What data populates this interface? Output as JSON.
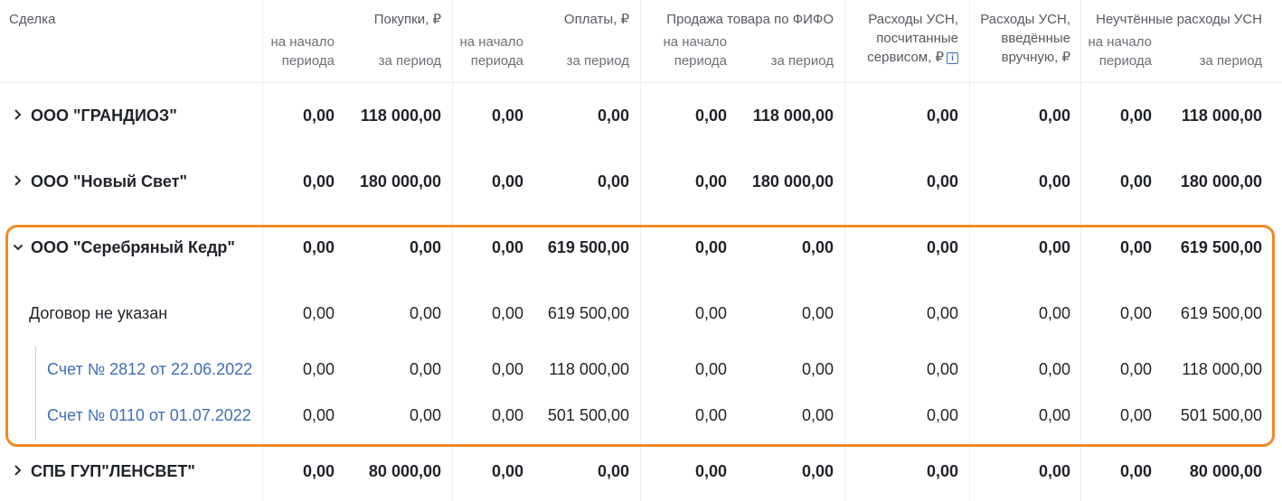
{
  "header": {
    "deal": "Сделка",
    "purchases": "Покупки, ₽",
    "payments": "Оплаты, ₽",
    "fifo": "Продажа товара по ФИФО",
    "usn_service_l1": "Расходы УСН,",
    "usn_service_l2": "посчитанные",
    "usn_service_l3": "сервисом, ₽",
    "usn_manual_l1": "Расходы УСН,",
    "usn_manual_l2": "введённые",
    "usn_manual_l3": "вручную, ₽",
    "unaccounted": "Неучтённые расходы УСН",
    "start_l1": "на начало",
    "start_l2": "периода",
    "period": "за период",
    "info_glyph": "i"
  },
  "rows": [
    {
      "name": "ООО \"ГРАНДИОЗ\"",
      "values": [
        "0,00",
        "118 000,00",
        "0,00",
        "0,00",
        "0,00",
        "118 000,00",
        "0,00",
        "0,00",
        "0,00",
        "118 000,00"
      ]
    },
    {
      "name": "ООО \"Новый Свет\"",
      "values": [
        "0,00",
        "180 000,00",
        "0,00",
        "0,00",
        "0,00",
        "180 000,00",
        "0,00",
        "0,00",
        "0,00",
        "180 000,00"
      ]
    },
    {
      "name": "ООО \"Серебряный Кедр\"",
      "values": [
        "0,00",
        "0,00",
        "0,00",
        "619 500,00",
        "0,00",
        "0,00",
        "0,00",
        "0,00",
        "0,00",
        "619 500,00"
      ]
    },
    {
      "name": "Договор не указан",
      "values": [
        "0,00",
        "0,00",
        "0,00",
        "619 500,00",
        "0,00",
        "0,00",
        "0,00",
        "0,00",
        "0,00",
        "619 500,00"
      ]
    },
    {
      "name": "Счет № 2812 от 22.06.2022",
      "values": [
        "0,00",
        "0,00",
        "0,00",
        "118 000,00",
        "0,00",
        "0,00",
        "0,00",
        "0,00",
        "0,00",
        "118 000,00"
      ]
    },
    {
      "name": "Счет № 0110 от 01.07.2022",
      "values": [
        "0,00",
        "0,00",
        "0,00",
        "501 500,00",
        "0,00",
        "0,00",
        "0,00",
        "0,00",
        "0,00",
        "501 500,00"
      ]
    },
    {
      "name": "СПБ ГУП\"ЛЕНСВЕТ\"",
      "values": [
        "0,00",
        "80 000,00",
        "0,00",
        "0,00",
        "0,00",
        "0,00",
        "0,00",
        "0,00",
        "0,00",
        "80 000,00"
      ]
    }
  ],
  "colors": {
    "accent": "#f08a24",
    "link": "#3f6fb5"
  }
}
